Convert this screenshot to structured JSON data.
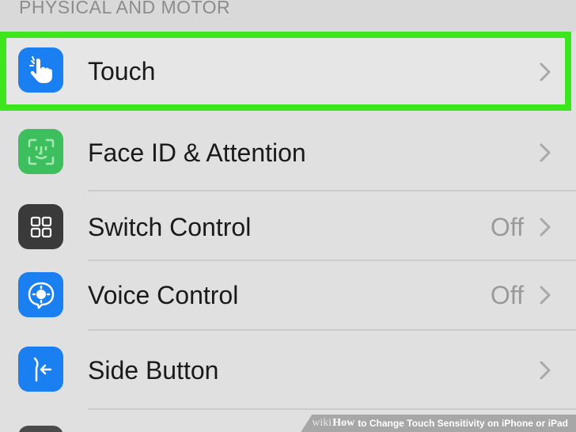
{
  "section_header": "PHYSICAL AND MOTOR",
  "rows": [
    {
      "label": "Touch",
      "value": "",
      "icon": "hand-touch-icon",
      "icon_bg": "#1a7ff0"
    },
    {
      "label": "Face ID & Attention",
      "value": "",
      "icon": "face-id-icon",
      "icon_bg": "#3dbf5e"
    },
    {
      "label": "Switch Control",
      "value": "Off",
      "icon": "switch-control-icon",
      "icon_bg": "#3a3a3a"
    },
    {
      "label": "Voice Control",
      "value": "Off",
      "icon": "voice-control-icon",
      "icon_bg": "#1a7ff0"
    },
    {
      "label": "Side Button",
      "value": "",
      "icon": "side-button-icon",
      "icon_bg": "#1a7ff0"
    }
  ],
  "highlight_color": "#3ce61c",
  "watermark": {
    "wiki": "wiki",
    "how": "How",
    "text": "to Change Touch Sensitivity on iPhone or iPad"
  }
}
